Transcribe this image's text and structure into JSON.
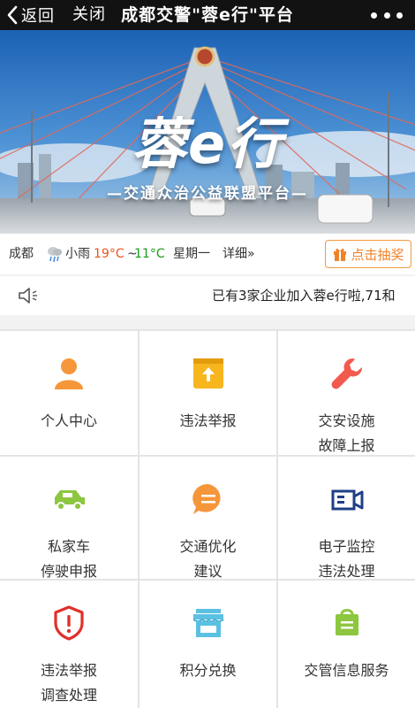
{
  "nav": {
    "back_label": "返回",
    "close_label": "关闭",
    "title": "成都交警\"蓉e行\"平台"
  },
  "banner": {
    "logo_text": "蓉e行",
    "slogan": "—交通众治公益联盟平台—"
  },
  "weather": {
    "city": "成都",
    "condition": "小雨",
    "high": "19°C",
    "tilde": "~",
    "low": "11°C",
    "day": "星期一",
    "detail_label": "详细»",
    "lottery_label": "点击抽奖"
  },
  "notice": {
    "text": "已有3家企业加入蓉e行啦,71和"
  },
  "grid": {
    "items": [
      {
        "line1": "个人中心",
        "line2": "",
        "icon": "person-icon"
      },
      {
        "line1": "违法举报",
        "line2": "",
        "icon": "upload-icon"
      },
      {
        "line1": "交安设施",
        "line2": "故障上报",
        "icon": "wrench-icon"
      },
      {
        "line1": "私家车",
        "line2": "停驶申报",
        "icon": "car-icon"
      },
      {
        "line1": "交通优化",
        "line2": "建议",
        "icon": "chat-icon"
      },
      {
        "line1": "电子监控",
        "line2": "违法处理",
        "icon": "camera-icon"
      },
      {
        "line1": "违法举报",
        "line2": "调查处理",
        "icon": "shield-alert-icon"
      },
      {
        "line1": "积分兑换",
        "line2": "",
        "icon": "store-icon"
      },
      {
        "line1": "交管信息服务",
        "line2": "",
        "icon": "bag-icon"
      }
    ]
  },
  "colors": {
    "nav_bg": "#121212",
    "accent_orange": "#f0832a",
    "temp_high": "#e8541c",
    "temp_low": "#1a9b1a"
  }
}
